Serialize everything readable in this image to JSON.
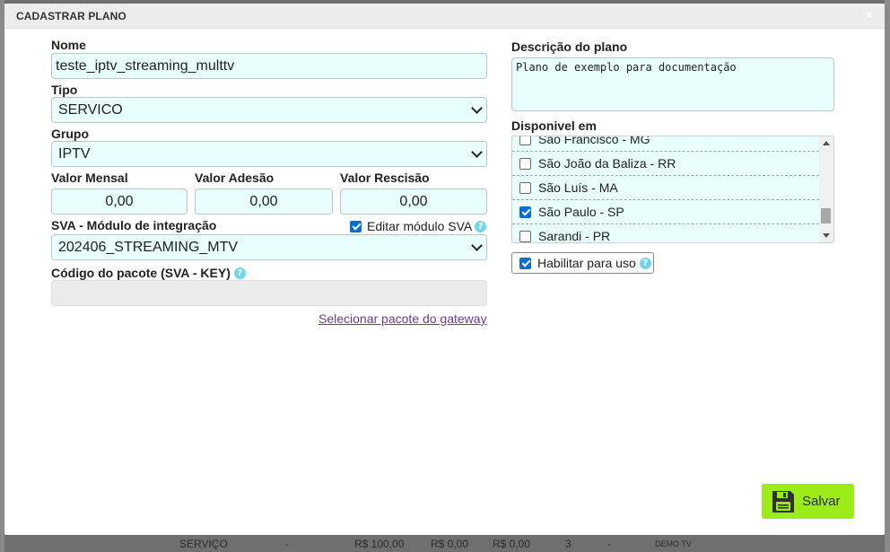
{
  "modal": {
    "title": "CADASTRAR PLANO",
    "close_glyph": "×"
  },
  "form": {
    "nome": {
      "label": "Nome",
      "value": "teste_iptv_streaming_multtv"
    },
    "tipo": {
      "label": "Tipo",
      "value": "SERVICO"
    },
    "grupo": {
      "label": "Grupo",
      "value": "IPTV"
    },
    "valor_mensal": {
      "label": "Valor Mensal",
      "value": "0,00"
    },
    "valor_adesao": {
      "label": "Valor Adesão",
      "value": "0,00"
    },
    "valor_rescisao": {
      "label": "Valor Rescisão",
      "value": "0,00"
    },
    "sva": {
      "label": "SVA - Módulo de integração",
      "value": "202406_STREAMING_MTV"
    },
    "editar_sva": {
      "label": "Editar módulo SVA",
      "checked": true
    },
    "codigo_pacote": {
      "label": "Código do pacote (SVA - KEY)",
      "value": ""
    },
    "selecionar_pacote_link": "Selecionar pacote do gateway",
    "descricao": {
      "label": "Descrição do plano",
      "value": "Plano de exemplo para documentação"
    },
    "disponivel": {
      "label": "Disponivel em",
      "items": [
        {
          "label": "São Francisco - MG",
          "checked": false
        },
        {
          "label": "São João da Baliza - RR",
          "checked": false
        },
        {
          "label": "São Luís - MA",
          "checked": false
        },
        {
          "label": "São Paulo - SP",
          "checked": true
        },
        {
          "label": "Sarandi - PR",
          "checked": false
        }
      ]
    },
    "habilitar": {
      "label": "Habilitar para uso",
      "checked": true
    }
  },
  "help_glyph": "?",
  "save_button": {
    "label": "Salvar"
  },
  "background_row": {
    "c1": "SERVIÇO",
    "c2": "-",
    "c3": "R$ 100,00",
    "c4": "R$ 0,00",
    "c5": "R$ 0,00",
    "c6": "3",
    "c7": "-",
    "c8": "DEMO TV"
  },
  "colors": {
    "field_bg": "#e8feff",
    "save_bg": "#9ced18",
    "checkbox_on": "#0b6fd1",
    "help": "#6fd6ec"
  }
}
